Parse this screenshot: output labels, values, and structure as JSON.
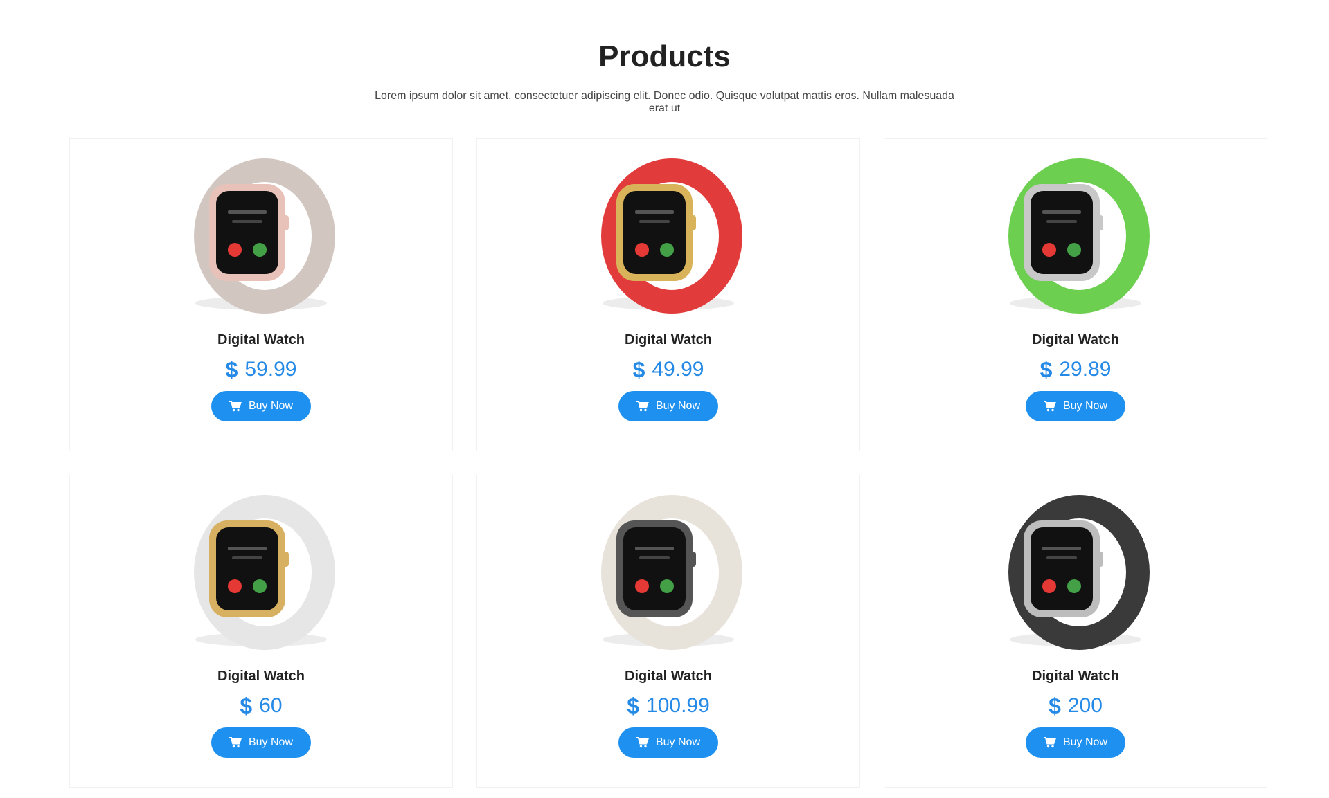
{
  "header": {
    "title": "Products",
    "subtitle": "Lorem ipsum dolor sit amet, consectetuer adipiscing elit. Donec odio. Quisque volutpat mattis eros. Nullam malesuada erat ut"
  },
  "colors": {
    "accent": "#1e90f0",
    "price": "#2589e6",
    "heading": "#222222"
  },
  "products": [
    {
      "name": "Digital Watch",
      "currency_icon": "dollar-icon",
      "price": "59.99",
      "button_label": "Buy Now",
      "button_icon": "cart-icon",
      "band_color": "#d2c6c0",
      "case_color": "#e8c2b8"
    },
    {
      "name": "Digital Watch",
      "currency_icon": "dollar-icon",
      "price": "49.99",
      "button_label": "Buy Now",
      "button_icon": "cart-icon",
      "band_color": "#e23b3b",
      "case_color": "#d9b35a"
    },
    {
      "name": "Digital Watch",
      "currency_icon": "dollar-icon",
      "price": "29.89",
      "button_label": "Buy Now",
      "button_icon": "cart-icon",
      "band_color": "#6dcf4f",
      "case_color": "#c8c8c8"
    },
    {
      "name": "Digital Watch",
      "currency_icon": "dollar-icon",
      "price": "60",
      "button_label": "Buy Now",
      "button_icon": "cart-icon",
      "band_color": "#e6e6e6",
      "case_color": "#d8b062"
    },
    {
      "name": "Digital Watch",
      "currency_icon": "dollar-icon",
      "price": "100.99",
      "button_label": "Buy Now",
      "button_icon": "cart-icon",
      "band_color": "#e8e3da",
      "case_color": "#555555"
    },
    {
      "name": "Digital Watch",
      "currency_icon": "dollar-icon",
      "price": "200",
      "button_label": "Buy Now",
      "button_icon": "cart-icon",
      "band_color": "#3a3a3a",
      "case_color": "#bdbdbd"
    }
  ]
}
